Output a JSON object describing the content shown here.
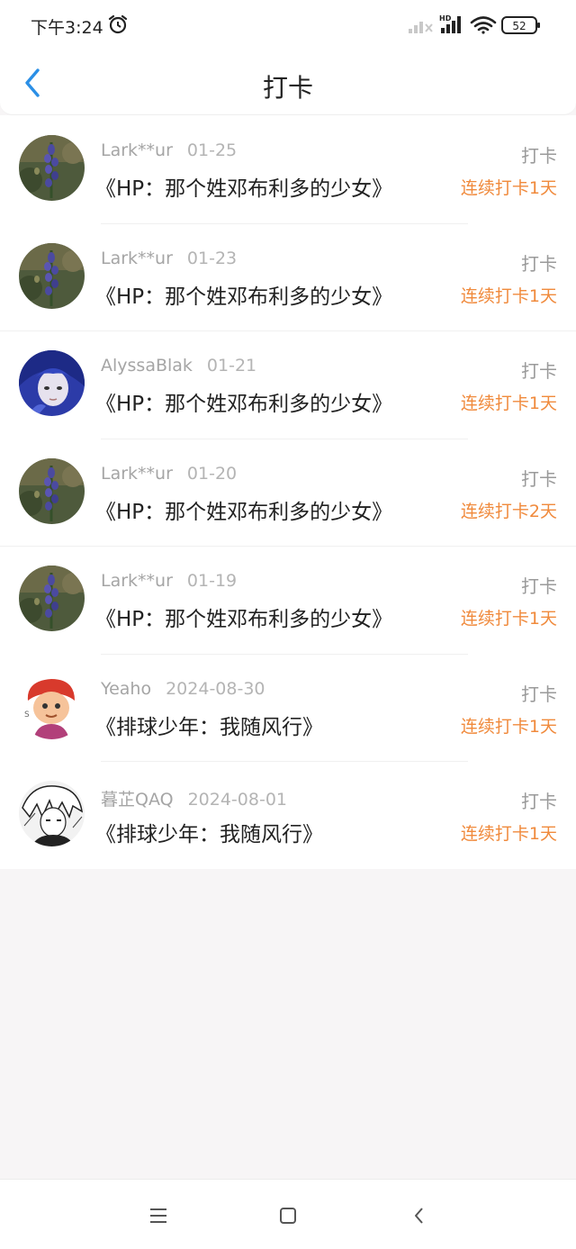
{
  "status_bar": {
    "time": "下午3:24",
    "network_label": "HD",
    "battery": "52",
    "icons": [
      "alarm-icon",
      "signal-off-icon",
      "signal-icon",
      "wifi-icon",
      "battery-icon"
    ]
  },
  "header": {
    "title": "打卡",
    "back_icon": "chevron-left-icon",
    "accent_color": "#2b8fe6"
  },
  "entries": [
    {
      "user": "Lark**ur",
      "date": "01-25",
      "book": "《HP：那个姓邓布利多的少女》",
      "action": "打卡",
      "streak": "连续打卡1天",
      "avatar": "flower"
    },
    {
      "user": "Lark**ur",
      "date": "01-23",
      "book": "《HP：那个姓邓布利多的少女》",
      "action": "打卡",
      "streak": "连续打卡1天",
      "avatar": "flower"
    },
    {
      "user": "AlyssaBlak",
      "date": "01-21",
      "book": "《HP：那个姓邓布利多的少女》",
      "action": "打卡",
      "streak": "连续打卡1天",
      "avatar": "anime-blue"
    },
    {
      "user": "Lark**ur",
      "date": "01-20",
      "book": "《HP：那个姓邓布利多的少女》",
      "action": "打卡",
      "streak": "连续打卡2天",
      "avatar": "flower"
    },
    {
      "user": "Lark**ur",
      "date": "01-19",
      "book": "《HP：那个姓邓布利多的少女》",
      "action": "打卡",
      "streak": "连续打卡1天",
      "avatar": "flower"
    },
    {
      "user": "Yeaho",
      "date": "2024-08-30",
      "book": "《排球少年：我随风行》",
      "action": "打卡",
      "streak": "连续打卡1天",
      "avatar": "cartoon-red"
    },
    {
      "user": "暮芷QAQ",
      "date": "2024-08-01",
      "book": "《排球少年：我随风行》",
      "action": "打卡",
      "streak": "连续打卡1天",
      "avatar": "manga-bw"
    }
  ],
  "colors": {
    "streak": "#f08a3c",
    "background": "#f7f5f6"
  },
  "bottom_nav": {
    "icons": [
      "menu-icon",
      "home-square-icon",
      "back-triangle-icon"
    ]
  }
}
